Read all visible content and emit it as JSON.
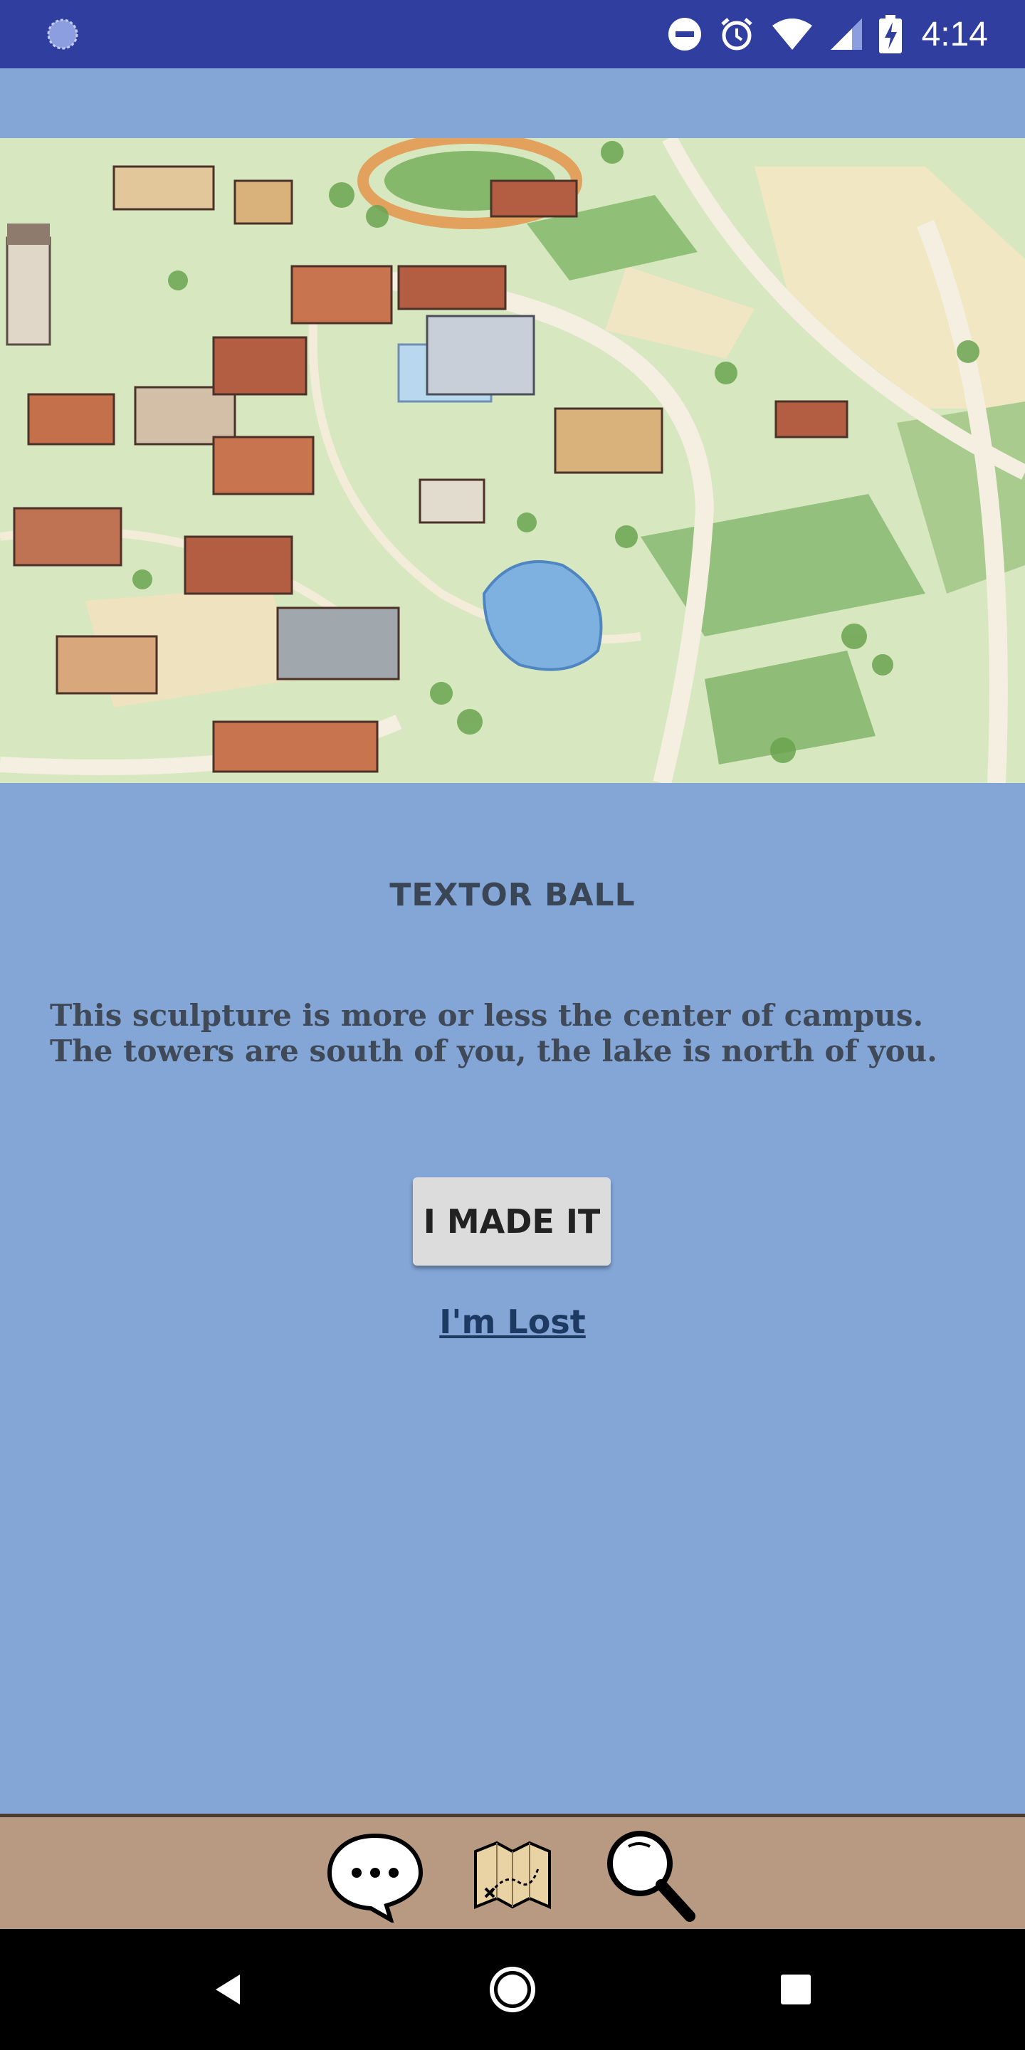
{
  "status_bar": {
    "time": "4:14"
  },
  "location": {
    "title": "TEXTOR BALL",
    "description": "This sculpture is more or less the center of campus. The towers are south of you, the lake is north of you."
  },
  "actions": {
    "made_it_label": "I MADE IT",
    "lost_label": "I'm Lost"
  },
  "bottom_nav": {
    "icons": [
      "chat-icon",
      "treasure-map-icon",
      "magnifier-icon"
    ]
  },
  "colors": {
    "status_bar": "#303f9f",
    "background": "#83a6d7",
    "bottom_bar": "#b89a82",
    "button": "#dcdcdc"
  }
}
